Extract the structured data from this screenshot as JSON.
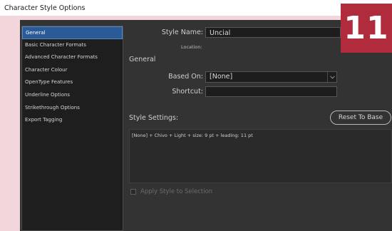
{
  "window": {
    "title": "Character Style Options"
  },
  "badge": {
    "text": "11"
  },
  "sidebar": {
    "items": [
      {
        "label": "General",
        "selected": true
      },
      {
        "label": "Basic Character Formats",
        "selected": false
      },
      {
        "label": "Advanced Character Formats",
        "selected": false
      },
      {
        "label": "Character Colour",
        "selected": false
      },
      {
        "label": "OpenType Features",
        "selected": false
      },
      {
        "label": "Underline Options",
        "selected": false
      },
      {
        "label": "Strikethrough Options",
        "selected": false
      },
      {
        "label": "Export Tagging",
        "selected": false
      }
    ]
  },
  "form": {
    "style_name_label": "Style Name:",
    "style_name_value": "Uncial",
    "location_label": "Location:",
    "section_title": "General",
    "based_on_label": "Based On:",
    "based_on_value": "[None]",
    "shortcut_label": "Shortcut:",
    "shortcut_value": "",
    "style_settings_label": "Style Settings:",
    "reset_button": "Reset To Base",
    "style_settings_text": "[None] + Chivo + Light + size: 9 pt + leading: 11 pt",
    "apply_label": "Apply Style to Selection",
    "apply_checked": false
  },
  "colors": {
    "dialog_bg": "#333333",
    "sidebar_bg": "#1e1e1e",
    "selection": "#2b5b97",
    "badge": "#b02b3c",
    "page_bg": "#f3d6dc"
  }
}
